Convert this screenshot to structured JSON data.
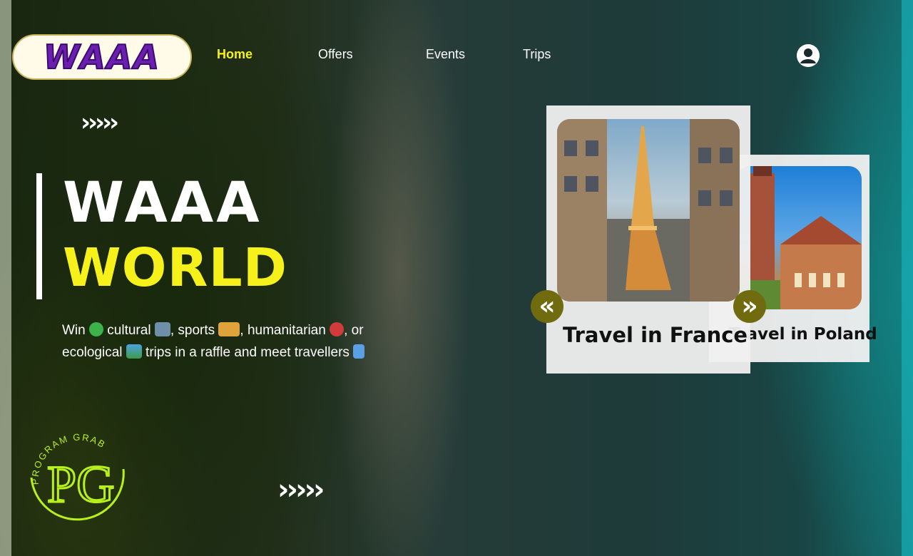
{
  "brand": {
    "logo_text": "WAAA",
    "badge_text": "PROGRAM GRAB",
    "badge_initials": "PG"
  },
  "nav": {
    "items": [
      {
        "label": "Home",
        "active": true
      },
      {
        "label": "Offers",
        "active": false
      },
      {
        "label": "Events",
        "active": false
      },
      {
        "label": "Trips",
        "active": false
      }
    ],
    "user_icon": "user-circle-icon"
  },
  "hero": {
    "chevrons": "›››››",
    "title_line1": "WAAA",
    "title_line2": "WORLD",
    "description": {
      "p1": "Win",
      "p2": " cultural ",
      "p3": ", sports ",
      "p4": ", humanitarian ",
      "p5": ", or ecological ",
      "p6": " trips in a raffle and meet travellers "
    }
  },
  "carousel": {
    "cards": [
      {
        "title": "Travel in France",
        "image": "eiffel-tower-photo"
      },
      {
        "title": "Travel in Poland",
        "image": "polish-town-hall-photo"
      }
    ],
    "prev_symbol": "«",
    "next_symbol": "»"
  },
  "footer": {
    "chevrons": "›››››"
  },
  "colors": {
    "accent_yellow": "#f6f11a",
    "logo_purple": "#6a1fb0",
    "arrow_olive": "#6f6b0e",
    "badge_green": "#b8f01a"
  }
}
